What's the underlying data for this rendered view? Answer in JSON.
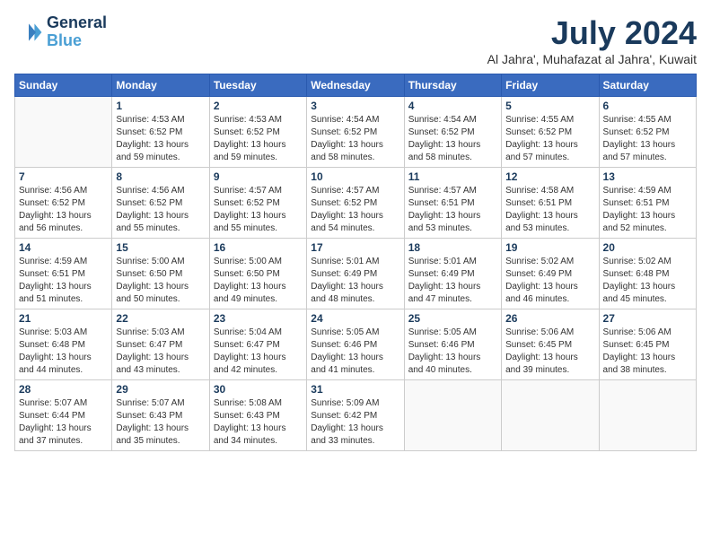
{
  "header": {
    "logo_line1": "General",
    "logo_line2": "Blue",
    "month_title": "July 2024",
    "subtitle": "Al Jahra', Muhafazat al Jahra', Kuwait"
  },
  "weekdays": [
    "Sunday",
    "Monday",
    "Tuesday",
    "Wednesday",
    "Thursday",
    "Friday",
    "Saturday"
  ],
  "weeks": [
    [
      {
        "day": "",
        "info": ""
      },
      {
        "day": "1",
        "info": "Sunrise: 4:53 AM\nSunset: 6:52 PM\nDaylight: 13 hours\nand 59 minutes."
      },
      {
        "day": "2",
        "info": "Sunrise: 4:53 AM\nSunset: 6:52 PM\nDaylight: 13 hours\nand 59 minutes."
      },
      {
        "day": "3",
        "info": "Sunrise: 4:54 AM\nSunset: 6:52 PM\nDaylight: 13 hours\nand 58 minutes."
      },
      {
        "day": "4",
        "info": "Sunrise: 4:54 AM\nSunset: 6:52 PM\nDaylight: 13 hours\nand 58 minutes."
      },
      {
        "day": "5",
        "info": "Sunrise: 4:55 AM\nSunset: 6:52 PM\nDaylight: 13 hours\nand 57 minutes."
      },
      {
        "day": "6",
        "info": "Sunrise: 4:55 AM\nSunset: 6:52 PM\nDaylight: 13 hours\nand 57 minutes."
      }
    ],
    [
      {
        "day": "7",
        "info": "Sunrise: 4:56 AM\nSunset: 6:52 PM\nDaylight: 13 hours\nand 56 minutes."
      },
      {
        "day": "8",
        "info": "Sunrise: 4:56 AM\nSunset: 6:52 PM\nDaylight: 13 hours\nand 55 minutes."
      },
      {
        "day": "9",
        "info": "Sunrise: 4:57 AM\nSunset: 6:52 PM\nDaylight: 13 hours\nand 55 minutes."
      },
      {
        "day": "10",
        "info": "Sunrise: 4:57 AM\nSunset: 6:52 PM\nDaylight: 13 hours\nand 54 minutes."
      },
      {
        "day": "11",
        "info": "Sunrise: 4:57 AM\nSunset: 6:51 PM\nDaylight: 13 hours\nand 53 minutes."
      },
      {
        "day": "12",
        "info": "Sunrise: 4:58 AM\nSunset: 6:51 PM\nDaylight: 13 hours\nand 53 minutes."
      },
      {
        "day": "13",
        "info": "Sunrise: 4:59 AM\nSunset: 6:51 PM\nDaylight: 13 hours\nand 52 minutes."
      }
    ],
    [
      {
        "day": "14",
        "info": "Sunrise: 4:59 AM\nSunset: 6:51 PM\nDaylight: 13 hours\nand 51 minutes."
      },
      {
        "day": "15",
        "info": "Sunrise: 5:00 AM\nSunset: 6:50 PM\nDaylight: 13 hours\nand 50 minutes."
      },
      {
        "day": "16",
        "info": "Sunrise: 5:00 AM\nSunset: 6:50 PM\nDaylight: 13 hours\nand 49 minutes."
      },
      {
        "day": "17",
        "info": "Sunrise: 5:01 AM\nSunset: 6:49 PM\nDaylight: 13 hours\nand 48 minutes."
      },
      {
        "day": "18",
        "info": "Sunrise: 5:01 AM\nSunset: 6:49 PM\nDaylight: 13 hours\nand 47 minutes."
      },
      {
        "day": "19",
        "info": "Sunrise: 5:02 AM\nSunset: 6:49 PM\nDaylight: 13 hours\nand 46 minutes."
      },
      {
        "day": "20",
        "info": "Sunrise: 5:02 AM\nSunset: 6:48 PM\nDaylight: 13 hours\nand 45 minutes."
      }
    ],
    [
      {
        "day": "21",
        "info": "Sunrise: 5:03 AM\nSunset: 6:48 PM\nDaylight: 13 hours\nand 44 minutes."
      },
      {
        "day": "22",
        "info": "Sunrise: 5:03 AM\nSunset: 6:47 PM\nDaylight: 13 hours\nand 43 minutes."
      },
      {
        "day": "23",
        "info": "Sunrise: 5:04 AM\nSunset: 6:47 PM\nDaylight: 13 hours\nand 42 minutes."
      },
      {
        "day": "24",
        "info": "Sunrise: 5:05 AM\nSunset: 6:46 PM\nDaylight: 13 hours\nand 41 minutes."
      },
      {
        "day": "25",
        "info": "Sunrise: 5:05 AM\nSunset: 6:46 PM\nDaylight: 13 hours\nand 40 minutes."
      },
      {
        "day": "26",
        "info": "Sunrise: 5:06 AM\nSunset: 6:45 PM\nDaylight: 13 hours\nand 39 minutes."
      },
      {
        "day": "27",
        "info": "Sunrise: 5:06 AM\nSunset: 6:45 PM\nDaylight: 13 hours\nand 38 minutes."
      }
    ],
    [
      {
        "day": "28",
        "info": "Sunrise: 5:07 AM\nSunset: 6:44 PM\nDaylight: 13 hours\nand 37 minutes."
      },
      {
        "day": "29",
        "info": "Sunrise: 5:07 AM\nSunset: 6:43 PM\nDaylight: 13 hours\nand 35 minutes."
      },
      {
        "day": "30",
        "info": "Sunrise: 5:08 AM\nSunset: 6:43 PM\nDaylight: 13 hours\nand 34 minutes."
      },
      {
        "day": "31",
        "info": "Sunrise: 5:09 AM\nSunset: 6:42 PM\nDaylight: 13 hours\nand 33 minutes."
      },
      {
        "day": "",
        "info": ""
      },
      {
        "day": "",
        "info": ""
      },
      {
        "day": "",
        "info": ""
      }
    ]
  ]
}
